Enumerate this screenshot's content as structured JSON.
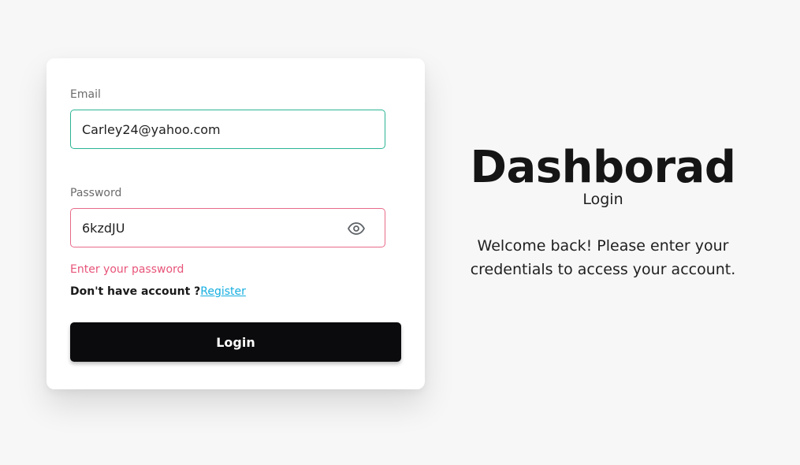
{
  "form": {
    "email_label": "Email",
    "email_value": "Carley24@yahoo.com",
    "password_label": "Password",
    "password_value": "6kzdJU",
    "password_error": "Enter your password",
    "no_account_text": "Don't have account ?",
    "register_link": "Register",
    "login_button": "Login",
    "eye_icon": "eye-icon"
  },
  "hero": {
    "title": "Dashborad",
    "subtitle": "Login",
    "welcome": "Welcome back! Please enter your credentials to access your account."
  },
  "colors": {
    "background": "#f7f7f7",
    "email_border": "#2bb594",
    "password_border": "#e86b8a",
    "error_text": "#e8557a",
    "link": "#16aee0",
    "button": "#0b0b0d"
  }
}
